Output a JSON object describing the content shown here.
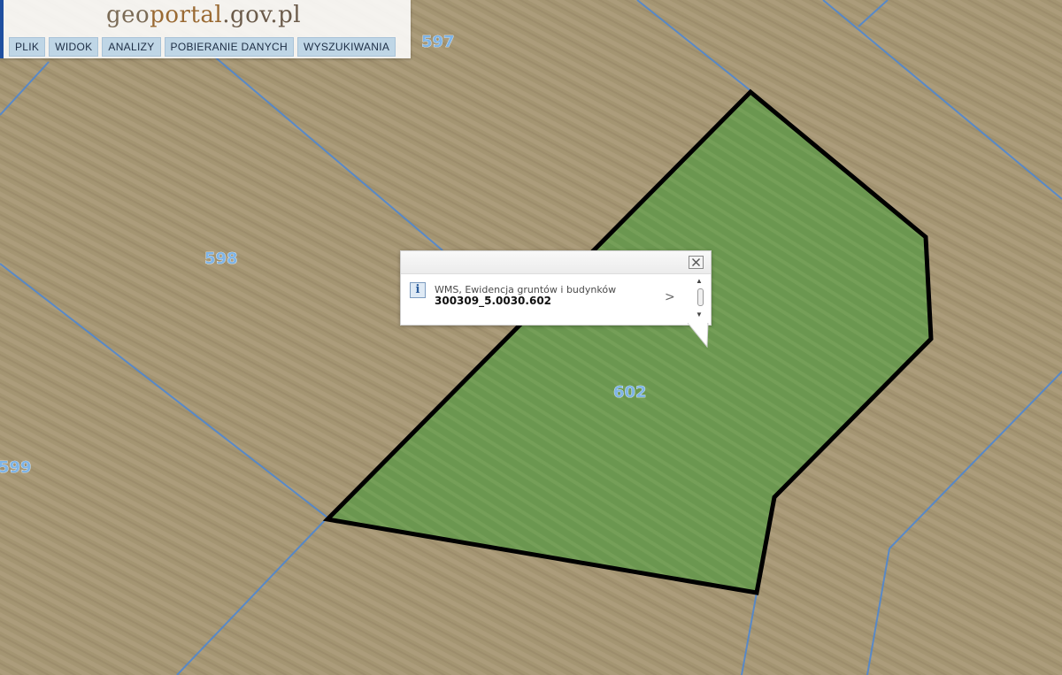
{
  "header": {
    "logo": {
      "part1": "geo",
      "part2": "portal",
      "part3": ".gov.pl"
    },
    "menu": [
      {
        "label": "PLIK"
      },
      {
        "label": "WIDOK"
      },
      {
        "label": "ANALIZY"
      },
      {
        "label": "POBIERANIE DANYCH"
      },
      {
        "label": "WYSZUKIWANIA"
      }
    ]
  },
  "map": {
    "parcel_labels": [
      "597",
      "598",
      "599",
      "602"
    ],
    "selected_parcel": "602",
    "colors": {
      "field": "#a59672",
      "selected_fill": "#6f9a4f",
      "parcel_border": "#4a86d6",
      "selected_outline": "#000000",
      "parcel_label": "#7fb4e6"
    }
  },
  "popup": {
    "layer_name": "WMS, Ewidencja gruntów i budynków",
    "feature_id": "300309_5.0030.602",
    "info_icon_text": "i",
    "next_symbol": ">",
    "icons": {
      "close": "close-icon",
      "info": "info-icon",
      "next": "chevron-right-icon",
      "scroll_up": "chevron-up-icon",
      "scroll_down": "chevron-down-icon"
    }
  }
}
